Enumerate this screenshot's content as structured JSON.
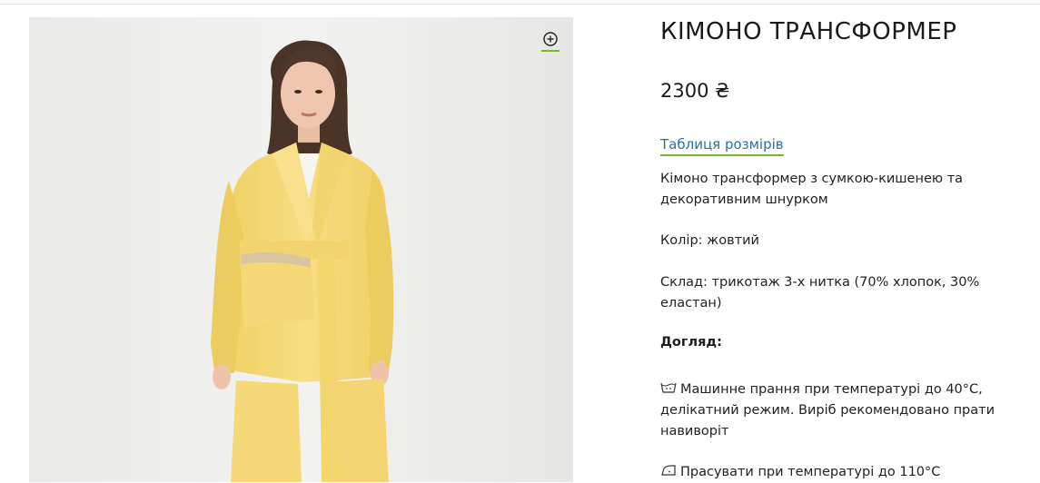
{
  "product": {
    "title": "КІМОНО ТРАНСФОРМЕР",
    "price": "2300 ₴",
    "size_table_link": "Таблиця розмірів",
    "description": "Кімоно трансформер з сумкою-кишенею та декоративним шнурком",
    "color": "Колір: жовтий",
    "composition": "Склад: трикотаж 3-х нитка (70% хлопок, 30% еластан)",
    "care_title": "Догляд:",
    "care_items": [
      {
        "icon": "washing-icon",
        "text": "Машинне прання при температурі до 40°C, делікатний режим. Виріб рекомендовано прати навиворіт"
      },
      {
        "icon": "iron-icon",
        "text": "Прасувати при температурі до 110°C"
      }
    ]
  },
  "gallery": {
    "zoom_icon": "zoom-in-icon"
  },
  "colors": {
    "accent": "#7ab929",
    "link": "#2b6fb0",
    "garment": "#f6dc7c"
  }
}
